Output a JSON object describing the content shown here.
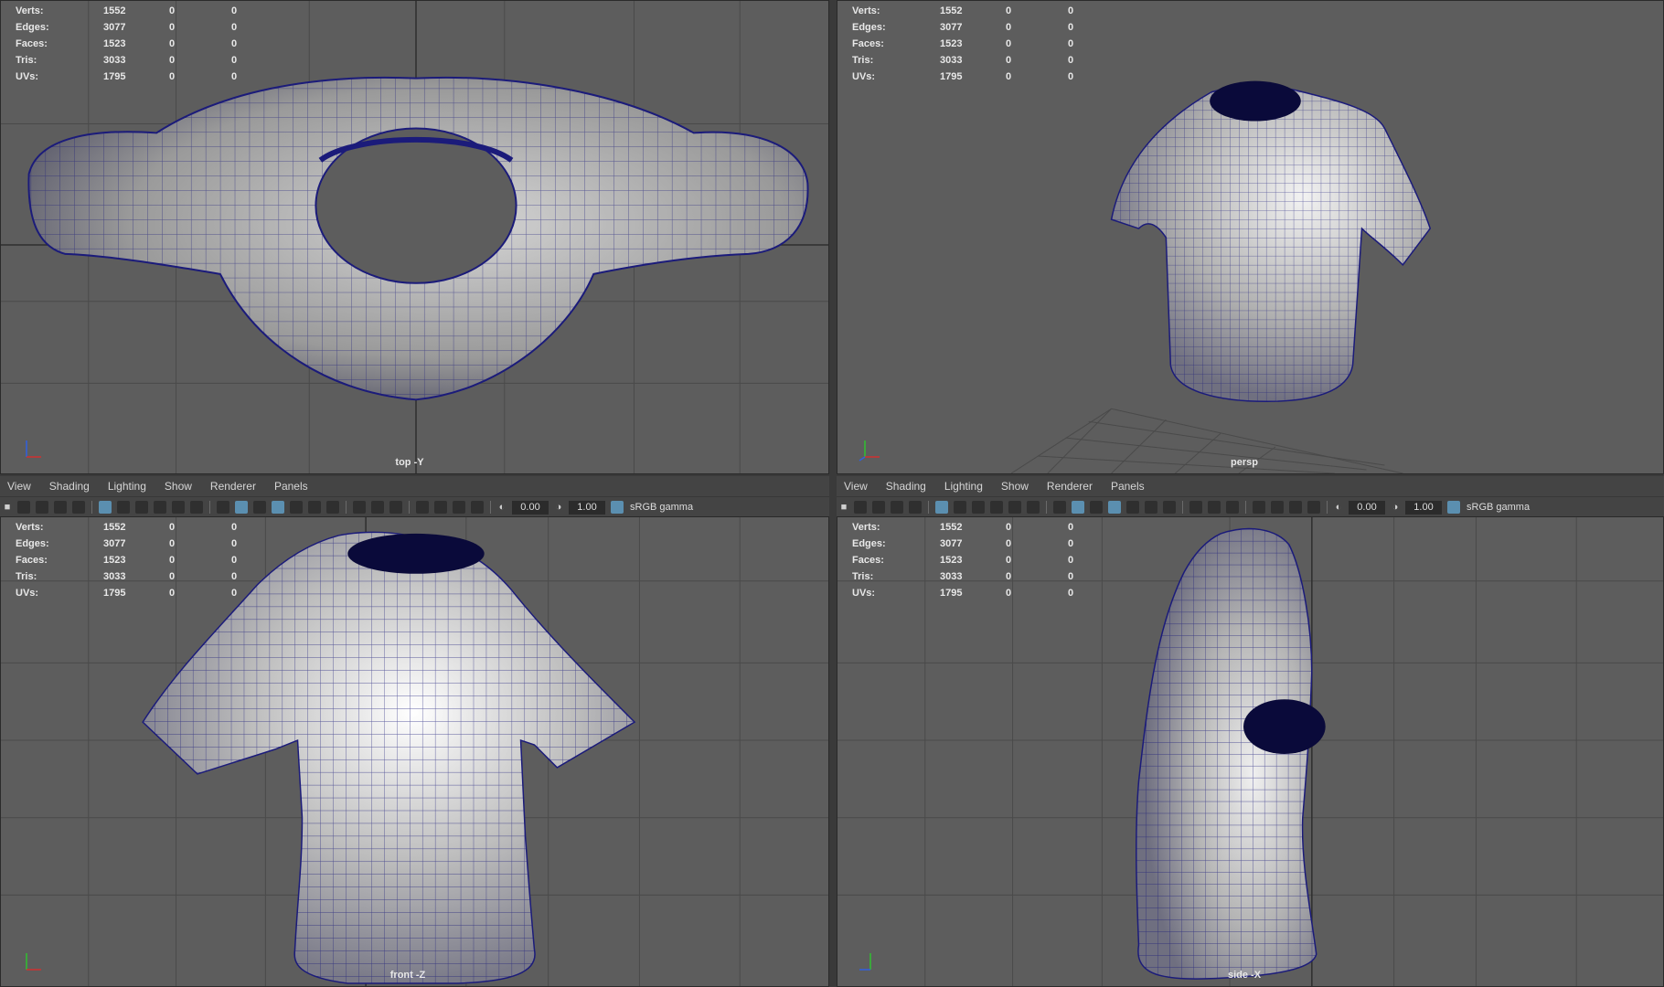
{
  "stats": {
    "rows": [
      {
        "label": "Verts:",
        "values": [
          "1552",
          "0",
          "0"
        ]
      },
      {
        "label": "Edges:",
        "values": [
          "3077",
          "0",
          "0"
        ]
      },
      {
        "label": "Faces:",
        "values": [
          "1523",
          "0",
          "0"
        ]
      },
      {
        "label": "Tris:",
        "values": [
          "3033",
          "0",
          "0"
        ]
      },
      {
        "label": "UVs:",
        "values": [
          "1795",
          "0",
          "0"
        ]
      }
    ]
  },
  "viewports": {
    "top": {
      "camera": "top -Y"
    },
    "persp": {
      "camera": "persp"
    },
    "front": {
      "camera": "front -Z"
    },
    "side": {
      "camera": "side -X"
    }
  },
  "menu": {
    "items": [
      "View",
      "Shading",
      "Lighting",
      "Show",
      "Renderer",
      "Panels"
    ]
  },
  "toolbar": {
    "exposure": "0.00",
    "gamma": "1.00",
    "color_space": "sRGB gamma"
  },
  "colors": {
    "viewport_bg": "#5d5d5d",
    "grid_line": "#4a4a4a",
    "grid_axis": "#2e2e2e",
    "mesh_fill": "#b9b9b9",
    "wireframe": "#1b1b7a",
    "axis_x": "#d03030",
    "axis_y": "#30c030",
    "axis_z": "#3060e0"
  }
}
